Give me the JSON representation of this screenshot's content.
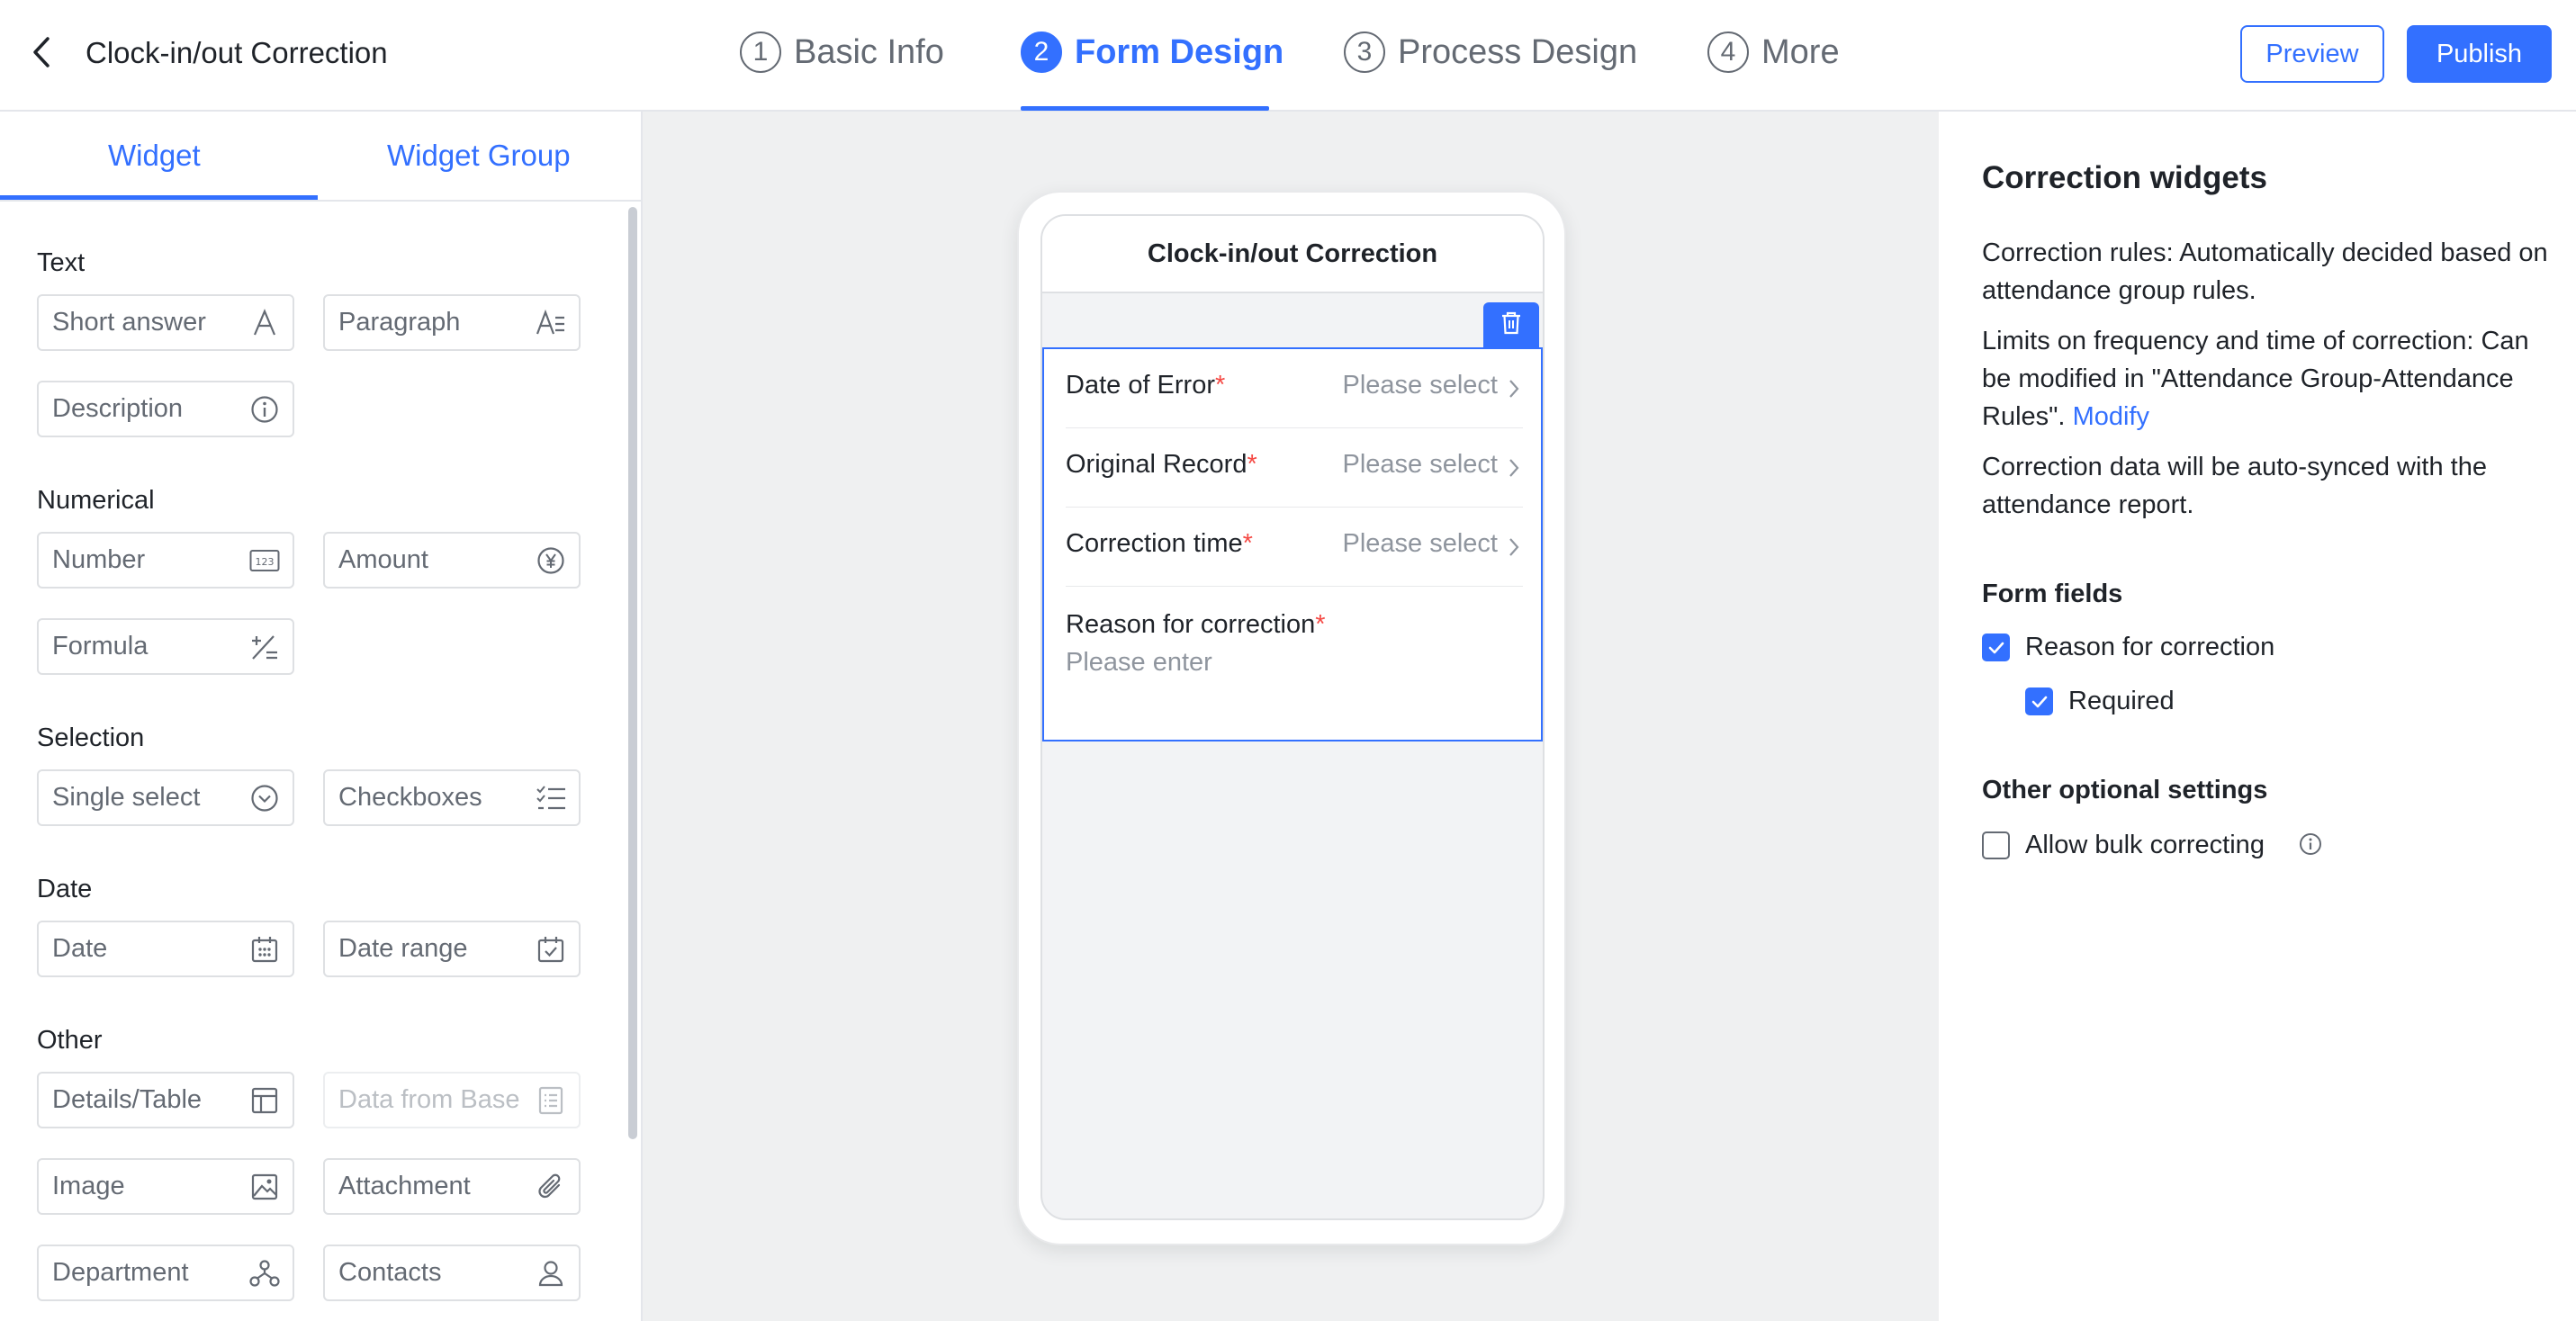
{
  "header": {
    "title": "Clock-in/out Correction",
    "steps": [
      {
        "num": "1",
        "label": "Basic Info"
      },
      {
        "num": "2",
        "label": "Form Design"
      },
      {
        "num": "3",
        "label": "Process Design"
      },
      {
        "num": "4",
        "label": "More"
      }
    ],
    "active_step": "Form Design",
    "preview_label": "Preview",
    "publish_label": "Publish"
  },
  "left_panel": {
    "tabs": [
      "Widget",
      "Widget Group"
    ],
    "active_tab": "Widget",
    "sections": [
      {
        "title": "Text",
        "items": [
          {
            "label": "Short answer",
            "icon": "short-answer-icon"
          },
          {
            "label": "Paragraph",
            "icon": "paragraph-icon"
          },
          {
            "label": "Description",
            "icon": "info-icon"
          }
        ]
      },
      {
        "title": "Numerical",
        "items": [
          {
            "label": "Number",
            "icon": "number-icon"
          },
          {
            "label": "Amount",
            "icon": "currency-icon"
          },
          {
            "label": "Formula",
            "icon": "formula-icon"
          }
        ]
      },
      {
        "title": "Selection",
        "items": [
          {
            "label": "Single select",
            "icon": "chevron-circle-icon"
          },
          {
            "label": "Checkboxes",
            "icon": "checklist-icon"
          }
        ]
      },
      {
        "title": "Date",
        "items": [
          {
            "label": "Date",
            "icon": "calendar-icon"
          },
          {
            "label": "Date range",
            "icon": "calendar-check-icon"
          }
        ]
      },
      {
        "title": "Other",
        "items": [
          {
            "label": "Details/Table",
            "icon": "table-icon"
          },
          {
            "label": "Data from Base",
            "icon": "list-doc-icon",
            "disabled": true
          },
          {
            "label": "Image",
            "icon": "image-icon"
          },
          {
            "label": "Attachment",
            "icon": "paperclip-icon"
          },
          {
            "label": "Department",
            "icon": "org-chart-icon"
          },
          {
            "label": "Contacts",
            "icon": "person-icon"
          }
        ]
      }
    ]
  },
  "preview": {
    "title": "Clock-in/out Correction",
    "fields": [
      {
        "label": "Date of Error",
        "required": "*",
        "placeholder": "Please select"
      },
      {
        "label": "Original Record",
        "required": "*",
        "placeholder": "Please select"
      },
      {
        "label": "Correction time",
        "required": "*",
        "placeholder": "Please select"
      }
    ],
    "reason": {
      "label": "Reason for correction",
      "required": "*",
      "placeholder": "Please enter"
    }
  },
  "right_panel": {
    "title": "Correction widgets",
    "para1": "Correction rules: Automatically decided based on attendance group rules.",
    "para2": "Limits on frequency and time of correction: Can be modified in \"Attendance Group-Attendance Rules\".",
    "modify_link": "Modify",
    "para3": "Correction data will be auto-synced with the attendance report.",
    "form_fields_title": "Form fields",
    "reason_checkbox": {
      "label": "Reason for correction",
      "checked": true
    },
    "required_checkbox": {
      "label": "Required",
      "checked": true
    },
    "other_title": "Other optional settings",
    "bulk_checkbox": {
      "label": "Allow bulk correcting",
      "checked": false
    }
  },
  "colors": {
    "accent": "#3370ff",
    "required": "#f54a45",
    "canvas_bg": "#eff0f1"
  }
}
